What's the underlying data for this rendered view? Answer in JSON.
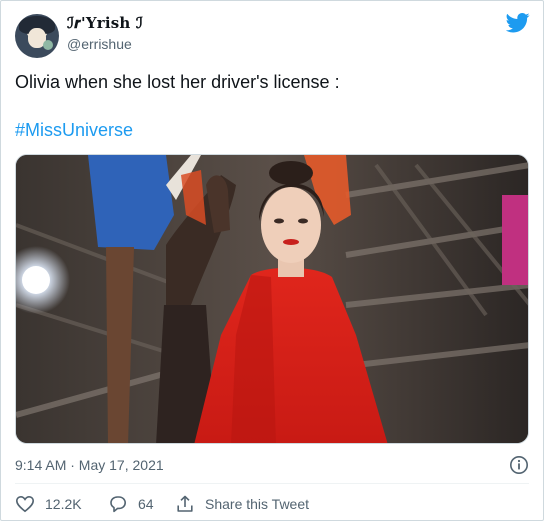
{
  "author": {
    "display_name": "ℐ𝒓'Yrish ℐ",
    "handle": "@errishue"
  },
  "tweet": {
    "text": "Olivia when she lost her driver's license :",
    "hashtag": "#MissUniverse",
    "timestamp": "9:14 AM · May 17, 2021"
  },
  "actions": {
    "likes": "12.2K",
    "replies": "64",
    "share_label": "Share this Tweet"
  },
  "icons": {
    "brand": "twitter-bird-icon",
    "info": "info-icon",
    "like": "heart-icon",
    "reply": "reply-bubble-icon",
    "share": "share-upload-icon"
  },
  "colors": {
    "accent": "#1d9bf0",
    "text": "#0f1419",
    "secondary": "#536471",
    "border": "#cfd9de"
  }
}
